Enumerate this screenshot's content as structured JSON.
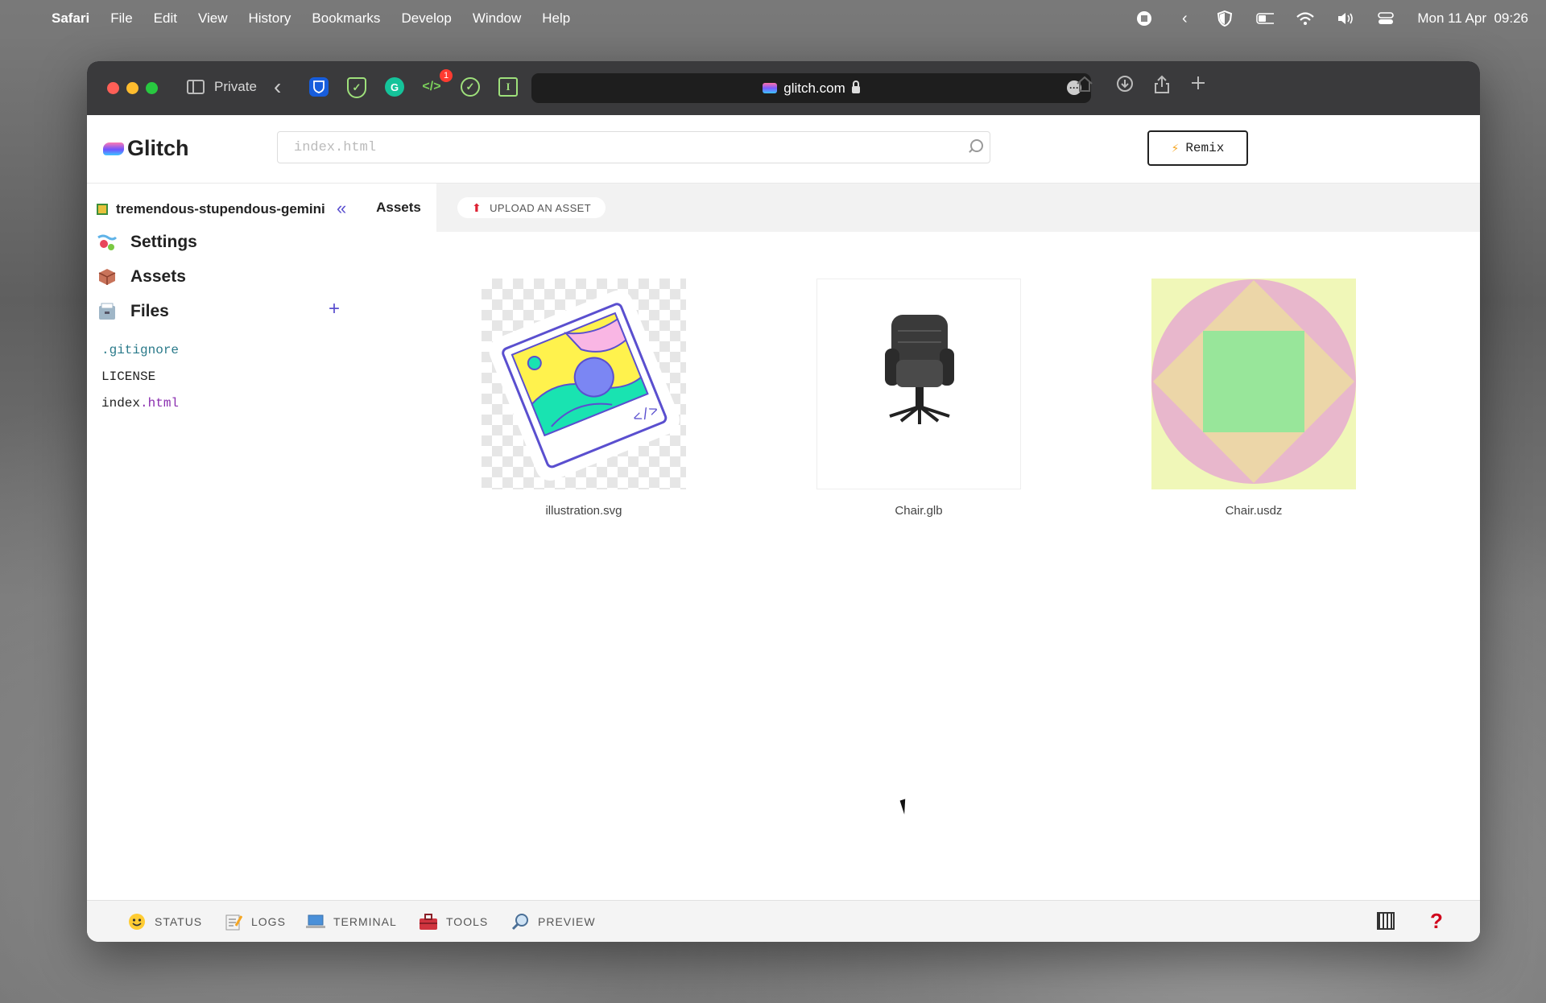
{
  "menubar": {
    "app": "Safari",
    "items": [
      "File",
      "Edit",
      "View",
      "History",
      "Bookmarks",
      "Develop",
      "Window",
      "Help"
    ],
    "clock": "Mon 11 Apr  09:26"
  },
  "browser": {
    "private_label": "Private",
    "url": "glitch.com",
    "extension_badge": "1"
  },
  "glitch": {
    "logo_text": "Glitch",
    "search_placeholder": "index.html",
    "remix_label": "Remix",
    "project_name": "tremendous-stupendous-gemini",
    "nav": [
      {
        "label": "Settings",
        "icon": "settings-icon"
      },
      {
        "label": "Assets",
        "icon": "box-icon"
      },
      {
        "label": "Files",
        "icon": "file-cabinet-icon"
      }
    ],
    "files": [
      {
        "prefix": ".gitignore",
        "suffix": ""
      },
      {
        "prefix": "LICENSE",
        "suffix": ""
      },
      {
        "prefix": "index",
        "suffix": ".html"
      }
    ],
    "tab_label": "Assets",
    "upload_label": "UPLOAD AN ASSET",
    "assets": [
      {
        "name": "illustration.svg"
      },
      {
        "name": "Chair.glb"
      },
      {
        "name": "Chair.usdz"
      }
    ],
    "bottom": [
      {
        "label": "STATUS",
        "icon": "smiley-icon"
      },
      {
        "label": "LOGS",
        "icon": "memo-icon"
      },
      {
        "label": "TERMINAL",
        "icon": "laptop-icon"
      },
      {
        "label": "TOOLS",
        "icon": "toolbox-icon"
      },
      {
        "label": "PREVIEW",
        "icon": "magnifier-icon"
      }
    ]
  },
  "colors": {
    "accent": "#5a4fcf",
    "help": "#d0021b",
    "browser_toolbar": "#3a3a3c"
  }
}
